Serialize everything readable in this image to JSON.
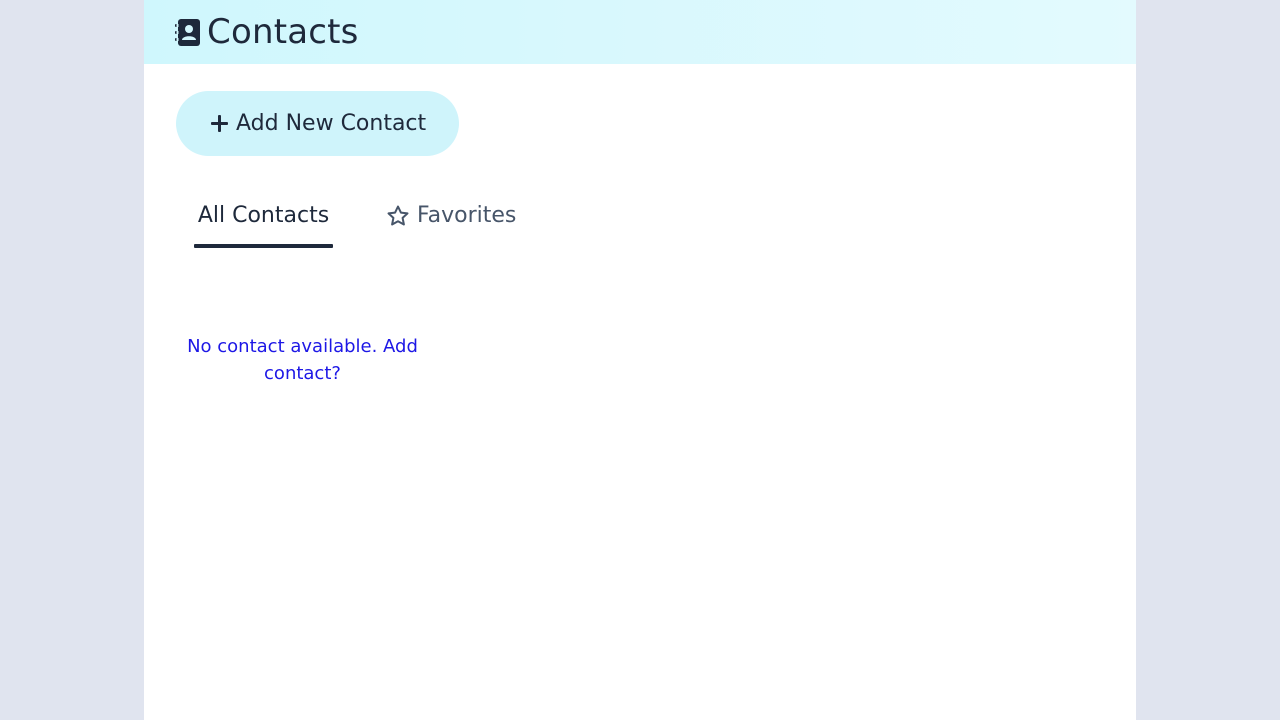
{
  "header": {
    "title": "Contacts",
    "icon": "address-book-icon"
  },
  "actions": {
    "add_contact_label": "Add New Contact",
    "add_contact_icon": "plus-icon"
  },
  "tabs": [
    {
      "label": "All Contacts",
      "active": true
    },
    {
      "label": "Favorites",
      "active": false,
      "icon": "star-icon"
    }
  ],
  "empty_state": {
    "message": "No contact available. Add contact?"
  },
  "colors": {
    "background": "#e0e4ef",
    "header_bg": "#cff7fd",
    "button_bg": "#cff4fb",
    "text": "#1e293b",
    "link": "#1d17e6"
  }
}
